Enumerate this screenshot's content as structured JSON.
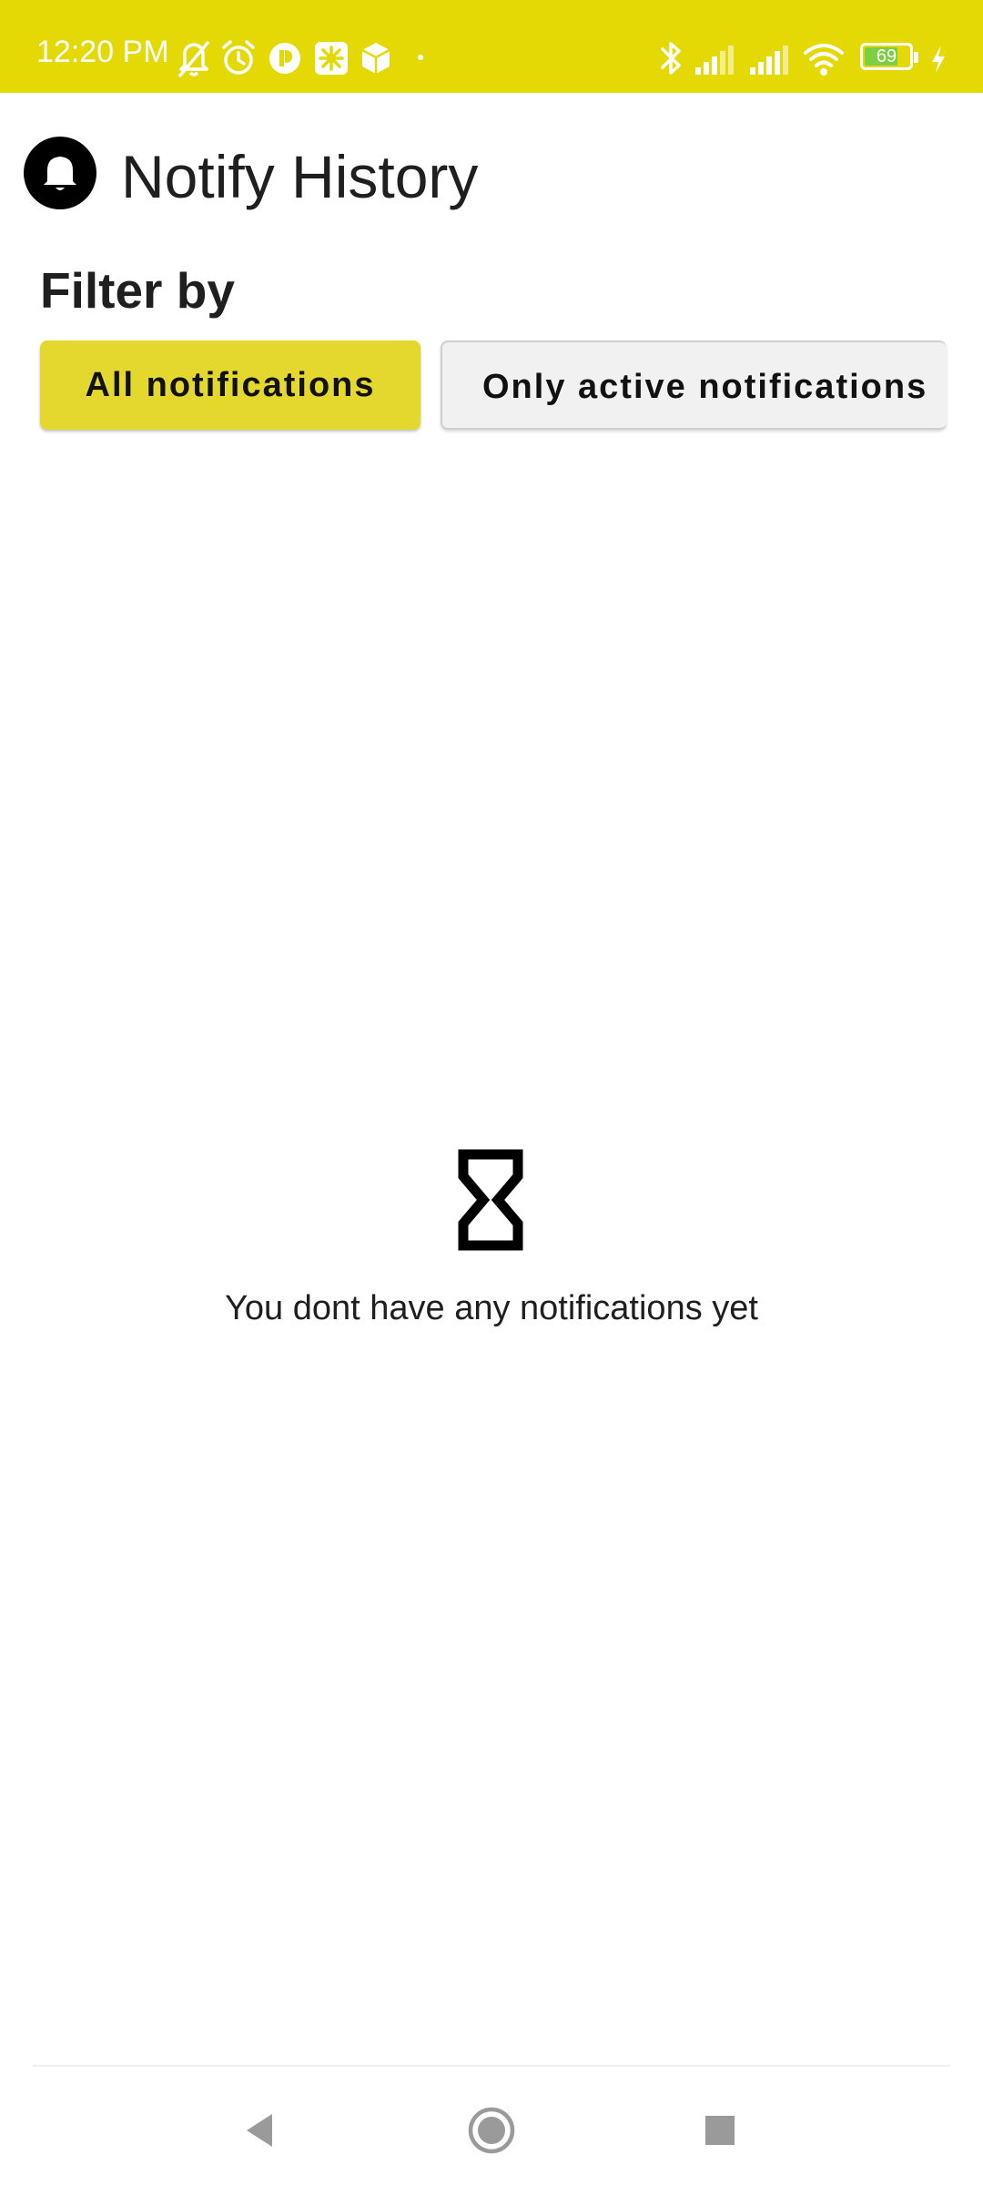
{
  "status_bar": {
    "time": "12:20 PM",
    "battery_level": "69",
    "background_color": "#e4d805",
    "icons": [
      "bell-off-icon",
      "alarm-icon",
      "app-icon-p",
      "app-icon-asterisk",
      "package-icon",
      "bluetooth-icon",
      "signal-icon",
      "signal-icon",
      "wifi-icon",
      "battery-icon",
      "charging-icon"
    ]
  },
  "header": {
    "title": "Notify History",
    "logo_icon": "bell-icon"
  },
  "filter": {
    "label": "Filter by",
    "options": [
      {
        "label": "All notifications",
        "selected": true
      },
      {
        "label": "Only active notifications",
        "selected": false
      }
    ],
    "accent_color": "#e4d82e"
  },
  "empty_state": {
    "icon": "hourglass-icon",
    "message": "You dont have any notifications yet"
  },
  "nav_bar": {
    "buttons": [
      "back-button",
      "home-button",
      "recents-button"
    ]
  }
}
